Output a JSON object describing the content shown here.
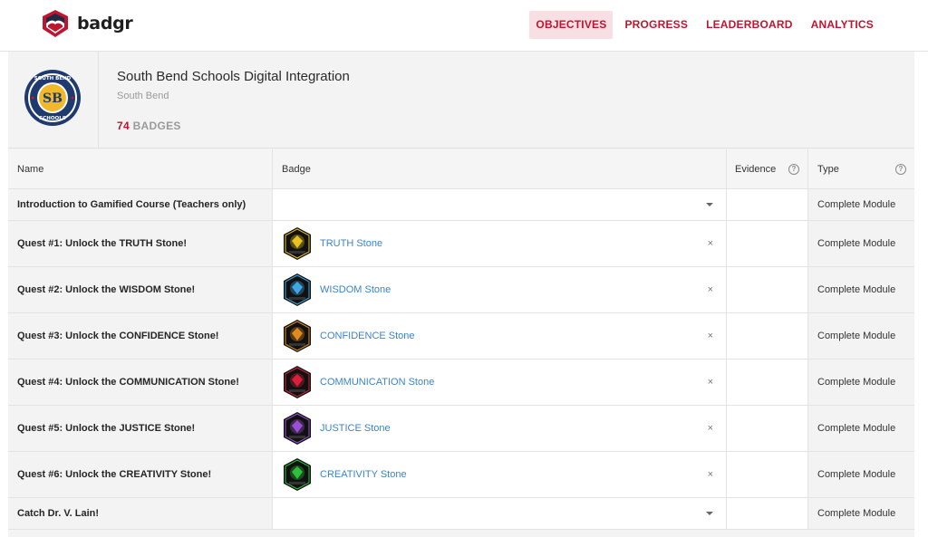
{
  "app": {
    "logo_text": "badgr"
  },
  "nav": [
    {
      "label": "OBJECTIVES",
      "active": true
    },
    {
      "label": "PROGRESS",
      "active": false
    },
    {
      "label": "LEADERBOARD",
      "active": false
    },
    {
      "label": "ANALYTICS",
      "active": false
    }
  ],
  "issuer": {
    "name": "South Bend Schools Digital Integration",
    "location": "South Bend",
    "logo_initials": "SB",
    "logo_ring_top": "SOUTH BEND",
    "logo_ring_bottom": "SCHOOLS",
    "badge_count": "74",
    "badge_count_label": "BADGES"
  },
  "table": {
    "headers": {
      "name": "Name",
      "badge": "Badge",
      "evidence": "Evidence",
      "type": "Type"
    },
    "rows": [
      {
        "name": "Introduction to Gamified Course (Teachers only)",
        "badge": "",
        "type": "Complete Module",
        "control": "dropdown"
      },
      {
        "name": "Quest #1: Unlock the TRUTH Stone!",
        "badge": "TRUTH Stone",
        "type": "Complete Module",
        "control": "remove",
        "stone_color": "#e8c21f"
      },
      {
        "name": "Quest #2: Unlock the WISDOM Stone!",
        "badge": "WISDOM Stone",
        "type": "Complete Module",
        "control": "remove",
        "stone_color": "#3fa7e6"
      },
      {
        "name": "Quest #3: Unlock the CONFIDENCE Stone!",
        "badge": "CONFIDENCE Stone",
        "type": "Complete Module",
        "control": "remove",
        "stone_color": "#e38a1c"
      },
      {
        "name": "Quest #4: Unlock the COMMUNICATION Stone!",
        "badge": "COMMUNICATION Stone",
        "type": "Complete Module",
        "control": "remove",
        "stone_color": "#d9203a"
      },
      {
        "name": "Quest #5: Unlock the JUSTICE Stone!",
        "badge": "JUSTICE Stone",
        "type": "Complete Module",
        "control": "remove",
        "stone_color": "#9a4fd6"
      },
      {
        "name": "Quest #6: Unlock the CREATIVITY Stone!",
        "badge": "CREATIVITY Stone",
        "type": "Complete Module",
        "control": "remove",
        "stone_color": "#2fbf3a"
      },
      {
        "name": "Catch Dr. V. Lain!",
        "badge": "",
        "type": "Complete Module",
        "control": "dropdown"
      }
    ]
  },
  "icons": {
    "help": "?",
    "remove": "×",
    "logo": "badgr-shield-icon",
    "issuer_logo": "south-bend-schools-seal"
  },
  "colors": {
    "brand_red": "#c0142f",
    "link_blue": "#3b84c8",
    "nav_active_bg": "#f7dfe3"
  }
}
